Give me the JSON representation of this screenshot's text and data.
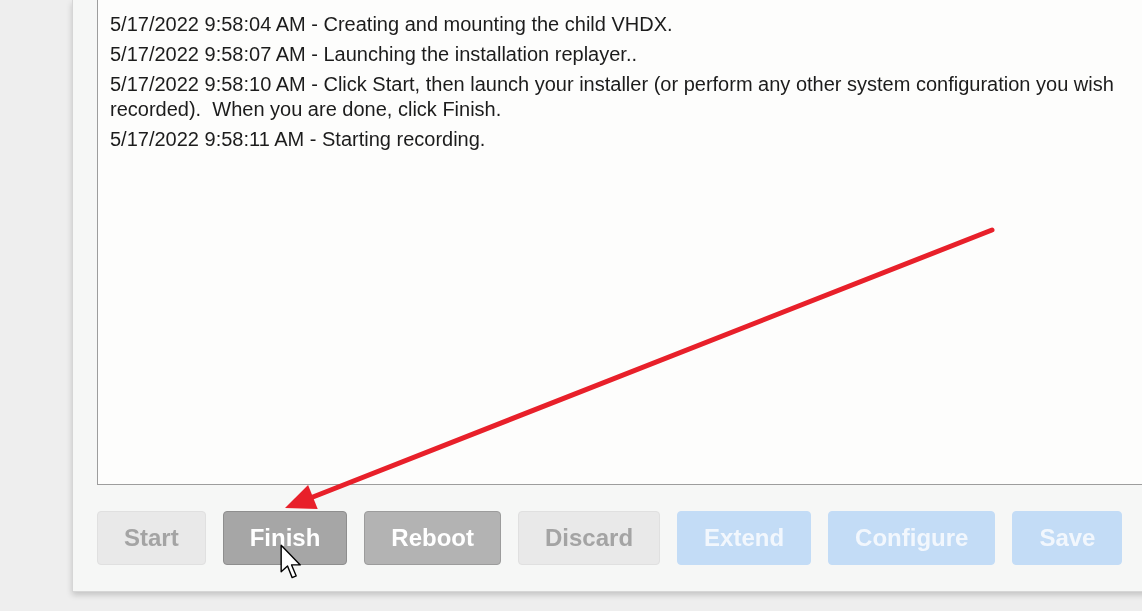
{
  "log": {
    "entries": [
      "5/17/2022 9:58:04 AM - Creating and mounting the child VHDX.",
      "5/17/2022 9:58:07 AM - Launching the installation replayer..",
      "5/17/2022 9:58:10 AM - Click Start, then launch your installer (or perform any other system configuration you wish recorded).  When you are done, click Finish.",
      "5/17/2022 9:58:11 AM - Starting recording."
    ]
  },
  "buttons": [
    {
      "label": "Start",
      "kind": "neutral",
      "disabled": true,
      "hovered": false
    },
    {
      "label": "Finish",
      "kind": "neutral",
      "disabled": false,
      "hovered": true
    },
    {
      "label": "Reboot",
      "kind": "neutral",
      "disabled": false,
      "hovered": false
    },
    {
      "label": "Discard",
      "kind": "neutral",
      "disabled": true,
      "hovered": false
    },
    {
      "label": "Extend",
      "kind": "primary",
      "disabled": true,
      "hovered": false
    },
    {
      "label": "Configure",
      "kind": "primary",
      "disabled": true,
      "hovered": false
    },
    {
      "label": "Save",
      "kind": "primary",
      "disabled": true,
      "hovered": false
    }
  ]
}
